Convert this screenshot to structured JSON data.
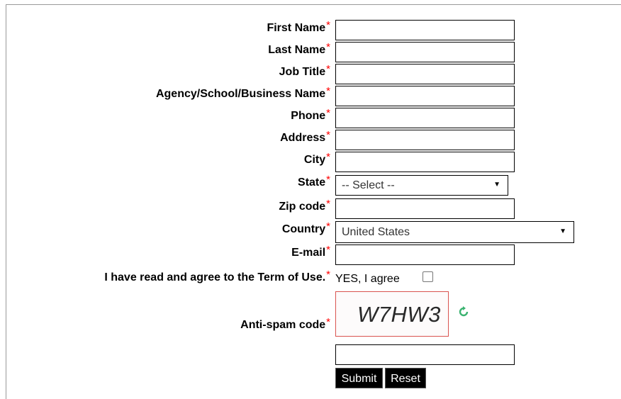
{
  "form": {
    "required_marker": "*",
    "fields": {
      "first_name": {
        "label": "First Name",
        "value": ""
      },
      "last_name": {
        "label": "Last Name",
        "value": ""
      },
      "job_title": {
        "label": "Job Title",
        "value": ""
      },
      "agency": {
        "label": "Agency/School/Business Name",
        "value": ""
      },
      "phone": {
        "label": "Phone",
        "value": ""
      },
      "address": {
        "label": "Address",
        "value": ""
      },
      "city": {
        "label": "City",
        "value": ""
      },
      "state": {
        "label": "State",
        "selected": "-- Select --"
      },
      "zip": {
        "label": "Zip code",
        "value": ""
      },
      "country": {
        "label": "Country",
        "selected": "United States"
      },
      "email": {
        "label": "E-mail",
        "value": ""
      }
    },
    "terms": {
      "label": "I have read and agree to the Term of Use.",
      "checkbox_text": "YES, I agree",
      "checked": false
    },
    "antispam": {
      "label": "Anti-spam code",
      "code": "W7HW3",
      "refresh_icon": "refresh-icon",
      "value": ""
    },
    "buttons": {
      "submit": "Submit",
      "reset": "Reset"
    }
  },
  "colors": {
    "required": "#ff0000",
    "captcha_border": "#d9534f",
    "refresh": "#3cb371",
    "button_bg": "#000000"
  }
}
